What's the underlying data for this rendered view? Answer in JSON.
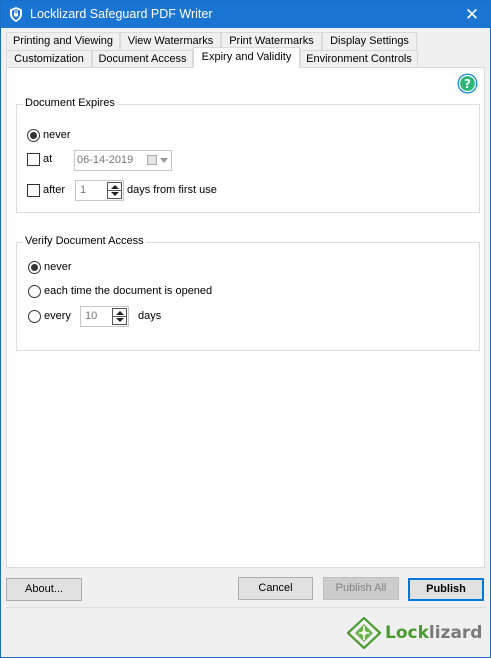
{
  "window": {
    "title": "Locklizard Safeguard PDF Writer",
    "close_label": "✕"
  },
  "tabs": {
    "row1": [
      {
        "label": "Printing and Viewing"
      },
      {
        "label": "View Watermarks"
      },
      {
        "label": "Print Watermarks"
      },
      {
        "label": "Display Settings"
      }
    ],
    "row2": [
      {
        "label": "Customization"
      },
      {
        "label": "Document Access"
      },
      {
        "label": "Expiry and Validity",
        "active": true
      },
      {
        "label": "Environment Controls"
      }
    ]
  },
  "help": {
    "icon": "help-icon",
    "glyph": "?"
  },
  "document_expires": {
    "group_label": "Document Expires",
    "never_label": "never",
    "never_selected": true,
    "at_label": "at",
    "at_checked": false,
    "date_value": "06-14-2019",
    "after_label": "after",
    "after_checked": false,
    "after_value": "1",
    "days_label": "days from first use"
  },
  "verify_access": {
    "group_label": "Verify Document Access",
    "never_label": "never",
    "never_selected": true,
    "each_label": "each time the document is opened",
    "every_label": "every",
    "every_value": "10",
    "days_label": "days"
  },
  "buttons": {
    "about": "About...",
    "cancel": "Cancel",
    "publish_all": "Publish All",
    "publish": "Publish"
  },
  "branding": {
    "wordmark_lock": "Lock",
    "wordmark_lizard": "lizard",
    "brand_color": "#4a9b2e"
  }
}
